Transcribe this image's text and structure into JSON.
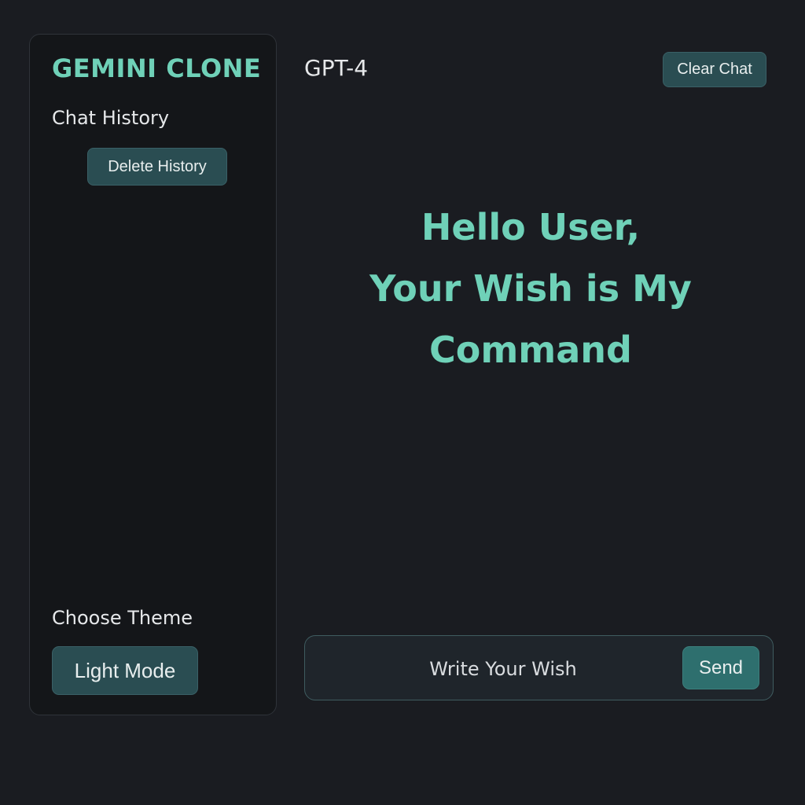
{
  "sidebar": {
    "brand": "GEMINI CLONE",
    "history_heading": "Chat History",
    "delete_history_label": "Delete History",
    "theme_heading": "Choose Theme",
    "theme_button_label": "Light Mode"
  },
  "header": {
    "model": "GPT-4",
    "clear_chat_label": "Clear Chat"
  },
  "main": {
    "greeting_lines": [
      "Hello User,",
      "Your Wish is My",
      "Command"
    ]
  },
  "composer": {
    "placeholder": "Write Your Wish",
    "send_label": "Send"
  },
  "colors": {
    "background": "#1a1c21",
    "accent": "#6fd1b8",
    "button": "#2a4d52"
  }
}
